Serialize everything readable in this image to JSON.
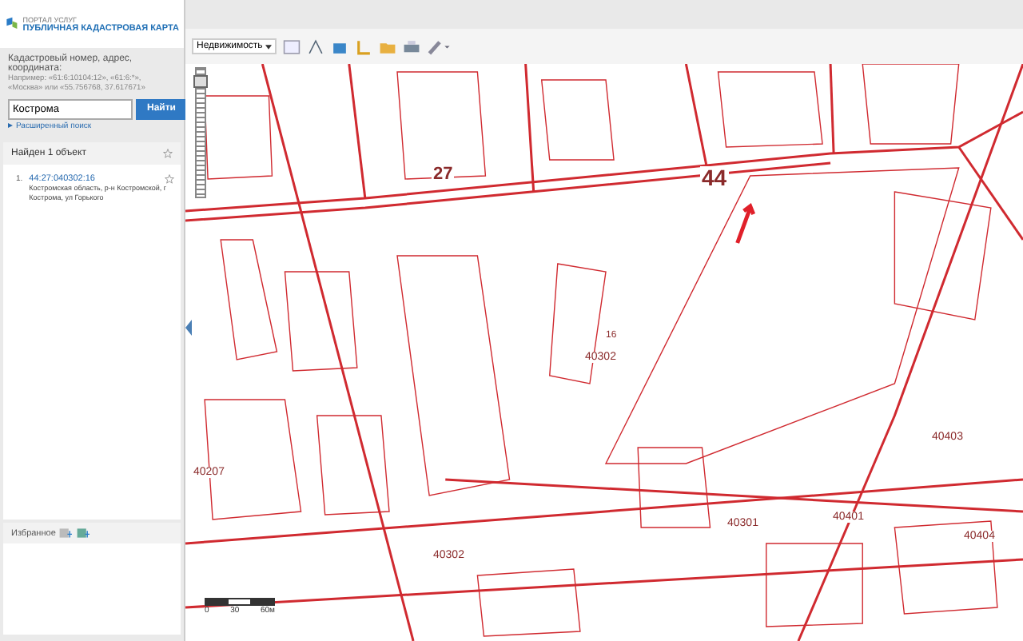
{
  "header": {
    "portal": "ПОРТАЛ УСЛУГ",
    "title": "ПУБЛИЧНАЯ КАДАСТРОВАЯ КАРТА"
  },
  "search": {
    "hint": "Кадастровый номер, адрес, координата:",
    "example": "Например: «61:6:10104:12», «61:6:*», «Москва» или «55.756768, 37.617671»",
    "value": "Кострома",
    "button": "Найти",
    "advanced": "Расширенный поиск"
  },
  "results": {
    "title": "Найден 1 объект",
    "items": [
      {
        "number": "1.",
        "id": "44:27:040302:16",
        "address": "Костромская область, р-н Костромской, г Кострома, ул Горького"
      }
    ]
  },
  "favorites": {
    "title": "Избранное"
  },
  "toolbar": {
    "layer": "Недвижимость"
  },
  "map": {
    "zoom": {
      "level": 0.95
    },
    "labels": [
      "27",
      "44",
      "16",
      "40302",
      "40403",
      "40207",
      "40404",
      "40401",
      "40301",
      "40302"
    ],
    "scale": [
      "0",
      "30",
      "60м"
    ]
  }
}
